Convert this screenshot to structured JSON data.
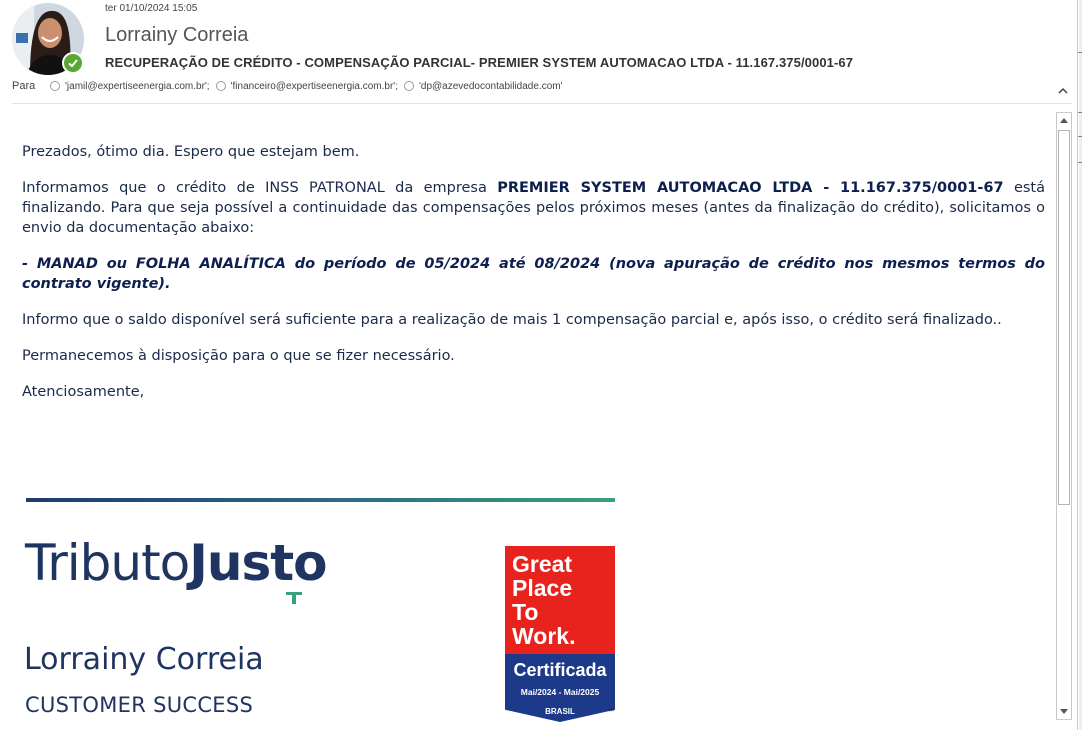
{
  "header": {
    "date": "ter 01/10/2024 15:05",
    "sender": "Lorrainy Correia",
    "subject": "RECUPERAÇÃO DE CRÉDITO - COMPENSAÇÃO PARCIAL- PREMIER SYSTEM AUTOMACAO LTDA - 11.167.375/0001-67",
    "to_label": "Para",
    "recipients": [
      "'jamil@expertiseenergia.com.br';",
      "'financeiro@expertiseenergia.com.br';",
      "'dp@azevedocontabilidade.com'"
    ],
    "presence_status": "available"
  },
  "body": {
    "greeting": "Prezados, ótimo dia. Espero que estejam bem.",
    "p1_start": "Informamos que o crédito de INSS PATRONAL da empresa ",
    "p1_bold": "PREMIER SYSTEM AUTOMACAO LTDA - 11.167.375/0001-67",
    "p1_end": " está finalizando. Para que seja possível a continuidade das compensações pelos próximos meses (antes da finalização do crédito), solicitamos o envio da documentação abaixo:",
    "request": "- MANAD ou FOLHA ANALÍTICA do período de 05/2024 até 08/2024 (nova apuração de crédito nos mesmos termos do contrato vigente).",
    "p3": "Informo que o saldo disponível será suficiente para a realização de mais 1 compensação parcial e, após isso, o crédito será finalizado..",
    "p4": "Permanecemos à disposição para o que se fizer necessário.",
    "closing": "Atenciosamente,"
  },
  "signature": {
    "logo_light": "Tributo",
    "logo_bold": "Justo",
    "name": "Lorrainy Correia",
    "role": "CUSTOMER SUCCESS",
    "badge": {
      "line1": "Great",
      "line2": "Place",
      "line3": "To",
      "line4": "Work.",
      "certified": "Certificada",
      "period": "Mai/2024 - Mai/2025",
      "country": "BRASIL",
      "tm": "™"
    }
  },
  "colors": {
    "text": "#1a2a4a",
    "brand": "#1f3460",
    "gptw_red": "#e8231d",
    "gptw_blue": "#1d3a8a",
    "presence": "#5aa832"
  }
}
